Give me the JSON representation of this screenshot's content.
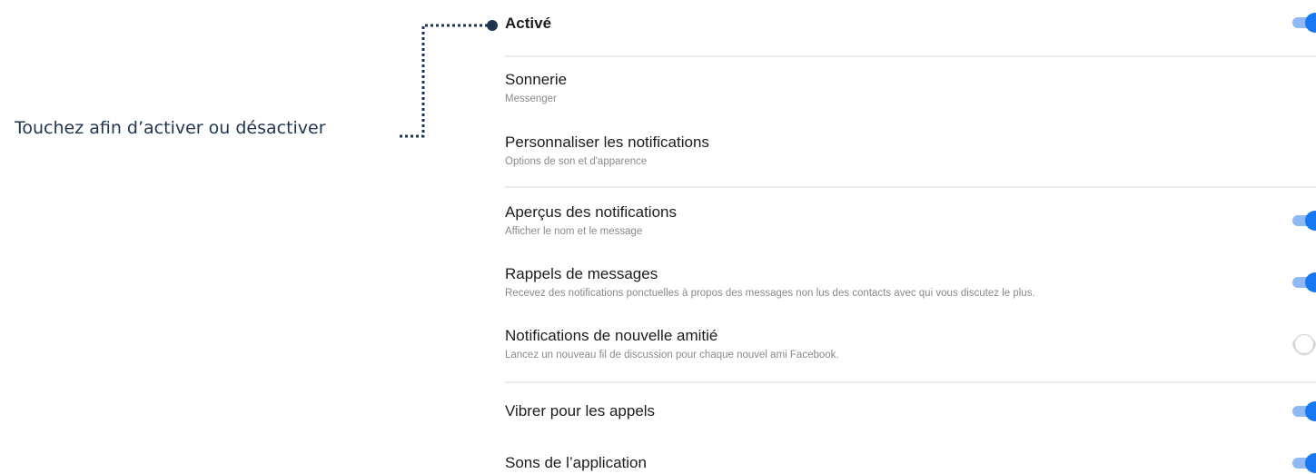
{
  "callout": {
    "text": "Touchez afin d’activer ou désactiver"
  },
  "settings": [
    {
      "title": "Activé",
      "subtitle": "",
      "toggle": "on"
    },
    {
      "title": "Sonnerie",
      "subtitle": "Messenger",
      "toggle": ""
    },
    {
      "title": "Personnaliser les notifications",
      "subtitle": "Options de son et d'apparence",
      "toggle": ""
    },
    {
      "title": "Aperçus des notifications",
      "subtitle": "Afficher le nom et le message",
      "toggle": "on"
    },
    {
      "title": "Rappels de messages",
      "subtitle": "Recevez des notifications ponctuelles à propos des messages non lus des contacts avec qui vous discutez le plus.",
      "toggle": "on"
    },
    {
      "title": "Notifications de nouvelle amitié",
      "subtitle": "Lancez un nouveau fil de discussion pour chaque nouvel ami Facebook.",
      "toggle": "off"
    },
    {
      "title": "Vibrer pour les appels",
      "subtitle": "",
      "toggle": "on"
    },
    {
      "title": "Sons de l’application",
      "subtitle": "",
      "toggle": "on"
    }
  ],
  "colors": {
    "accent": "#1877f2",
    "callout": "#1f3550"
  }
}
